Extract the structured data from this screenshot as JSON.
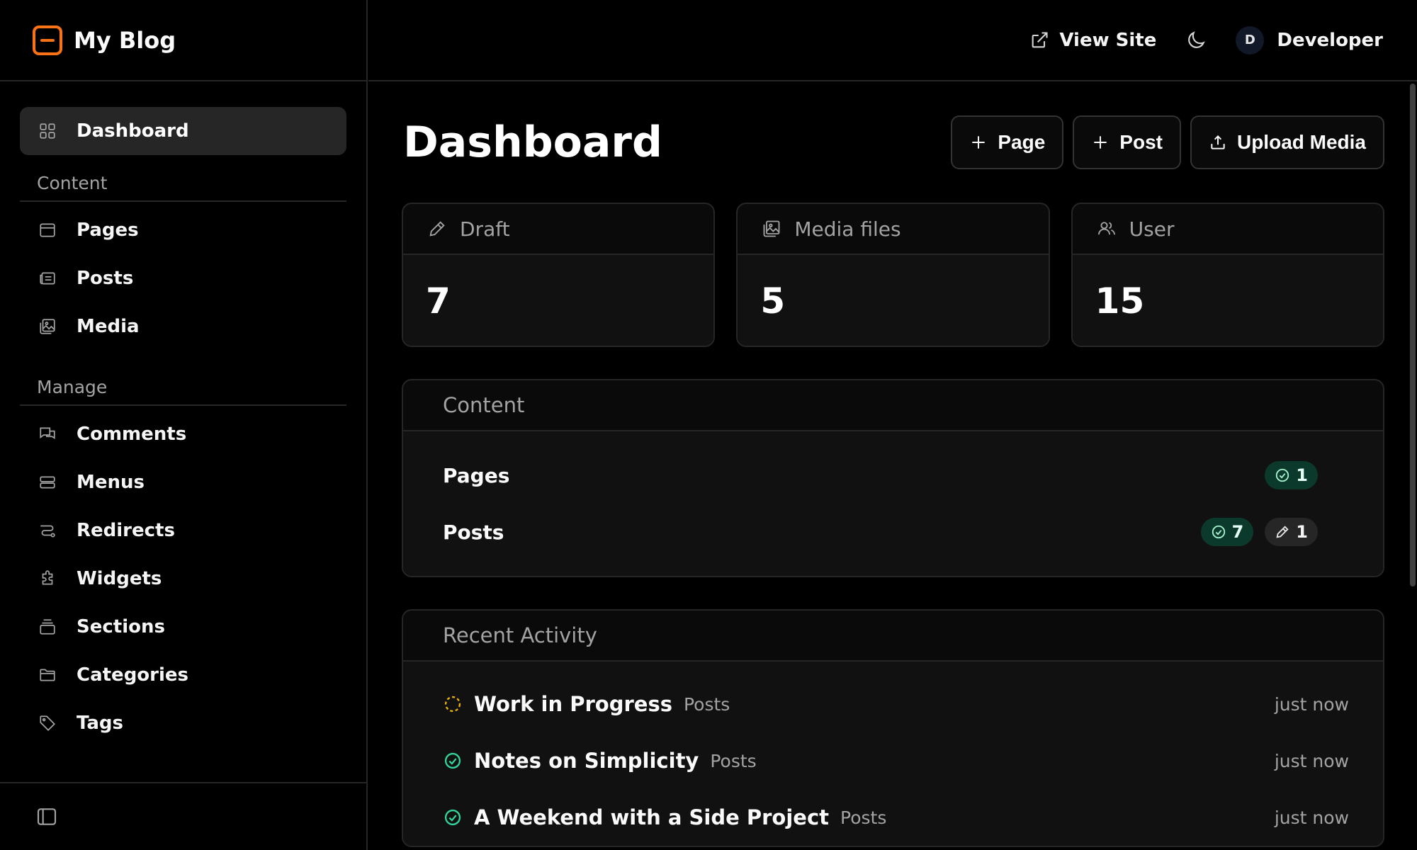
{
  "brand": {
    "name": "My Blog"
  },
  "topbar": {
    "view_site": "View Site",
    "user_initial": "D",
    "user_name": "Developer"
  },
  "sidebar": {
    "dashboard": "Dashboard",
    "section_content": "Content",
    "content_items": [
      "Pages",
      "Posts",
      "Media"
    ],
    "section_manage": "Manage",
    "manage_items": [
      "Comments",
      "Menus",
      "Redirects",
      "Widgets",
      "Sections",
      "Categories",
      "Tags"
    ]
  },
  "main": {
    "title": "Dashboard",
    "actions": {
      "page": "Page",
      "post": "Post",
      "upload": "Upload Media"
    },
    "stats": [
      {
        "label": "Draft",
        "value": "7"
      },
      {
        "label": "Media files",
        "value": "5"
      },
      {
        "label": "User",
        "value": "15"
      }
    ],
    "content_panel": {
      "title": "Content",
      "rows": [
        {
          "label": "Pages",
          "published": "1"
        },
        {
          "label": "Posts",
          "published": "7",
          "draft": "1"
        }
      ]
    },
    "activity_panel": {
      "title": "Recent Activity",
      "rows": [
        {
          "title": "Work in Progress",
          "type": "Posts",
          "time": "just now",
          "status": "draft"
        },
        {
          "title": "Notes on Simplicity",
          "type": "Posts",
          "time": "just now",
          "status": "published"
        },
        {
          "title": "A Weekend with a Side Project",
          "type": "Posts",
          "time": "just now",
          "status": "published"
        }
      ]
    }
  },
  "colors": {
    "accent": "#f97316",
    "published_bg": "#0b3a2c",
    "draft_status": "#eab308",
    "success": "#34d399"
  }
}
